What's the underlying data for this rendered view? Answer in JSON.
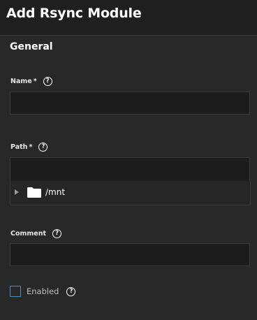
{
  "dialog": {
    "title": "Add Rsync Module"
  },
  "general": {
    "section_title": "General",
    "name": {
      "label": "Name",
      "required_mark": "*",
      "value": "",
      "help": "?"
    },
    "path": {
      "label": "Path",
      "required_mark": "*",
      "value": "",
      "help": "?",
      "tree": {
        "node_label": "/mnt",
        "expanded": false
      }
    },
    "comment": {
      "label": "Comment",
      "value": "",
      "help": "?"
    },
    "enabled": {
      "label": "Enabled",
      "checked": false,
      "help": "?"
    }
  },
  "colors": {
    "background": "#282828",
    "input_background": "#1d1d1d",
    "checkbox_border": "#4a90c4"
  },
  "icons": {
    "help": "help-circle-icon",
    "folder": "folder-icon",
    "expand": "triangle-right-icon"
  }
}
